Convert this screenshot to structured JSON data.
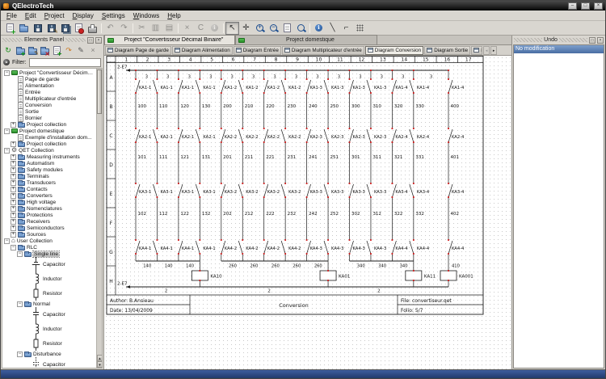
{
  "window": {
    "title": "QElectroTech"
  },
  "menu": {
    "items": [
      "File",
      "Edit",
      "Project",
      "Display",
      "Settings",
      "Windows",
      "Help"
    ]
  },
  "toolbar": {
    "buttons": [
      {
        "name": "new-diagram",
        "kind": "page",
        "ov": "plus"
      },
      {
        "name": "open-project",
        "kind": "folder"
      },
      {
        "name": "save",
        "kind": "floppy"
      },
      {
        "name": "save-as",
        "kind": "floppy",
        "ov": "pencil"
      },
      {
        "name": "save-all",
        "kind": "floppy",
        "ov": "stack"
      },
      {
        "name": "close-project",
        "kind": "page",
        "ov": "reddot"
      },
      {
        "name": "print",
        "kind": "printer"
      },
      {
        "sep": true
      },
      {
        "name": "undo",
        "glyph": "↶",
        "disabled": true
      },
      {
        "name": "redo",
        "glyph": "↷",
        "disabled": true
      },
      {
        "sep": true
      },
      {
        "name": "cut",
        "glyph": "✂",
        "disabled": true
      },
      {
        "name": "copy",
        "glyph": "▥",
        "disabled": true
      },
      {
        "name": "paste",
        "glyph": "▤",
        "disabled": true
      },
      {
        "sep": true
      },
      {
        "name": "delete",
        "glyph": "×",
        "disabled": true
      },
      {
        "name": "rotate",
        "glyph": "C",
        "disabled": true
      },
      {
        "name": "element-infos",
        "kind": "info",
        "disabled": true
      },
      {
        "sep": true
      },
      {
        "name": "select-mode",
        "glyph": "↖",
        "selected": true
      },
      {
        "name": "pan-mode",
        "glyph": "✛"
      },
      {
        "name": "zoom-in",
        "kind": "zoom",
        "glyph": "+"
      },
      {
        "name": "zoom-out",
        "kind": "zoom",
        "glyph": "−"
      },
      {
        "name": "zoom-content",
        "kind": "page"
      },
      {
        "name": "zoom-fit",
        "kind": "zoom"
      },
      {
        "sep": true
      },
      {
        "name": "diagram-properties",
        "kind": "info",
        "variant": "blue"
      },
      {
        "name": "add-line",
        "glyph": "╲"
      },
      {
        "name": "add-polyline",
        "glyph": "⌐"
      },
      {
        "name": "conductor-array",
        "kind": "grid"
      }
    ]
  },
  "elements_panel": {
    "title": "Elements Panel",
    "toolbar": [
      {
        "name": "reload-collections",
        "glyph": "↻",
        "color": "#138a13"
      },
      {
        "name": "new-category",
        "kind": "folder",
        "ov": "plus"
      },
      {
        "name": "edit-category",
        "kind": "folder",
        "ov": "pencil"
      },
      {
        "name": "delete-category",
        "kind": "folder",
        "ov": "cross"
      },
      {
        "name": "new-element",
        "kind": "page",
        "ov": "plus"
      },
      {
        "name": "import-element",
        "glyph": "↷",
        "color": "#cc7a22"
      },
      {
        "name": "edit-element",
        "glyph": "✎",
        "color": "#555555"
      },
      {
        "name": "delete-element",
        "glyph": "×",
        "disabled": true
      }
    ],
    "filter_label": "Filter:",
    "filter_value": "",
    "tree": [
      {
        "label": "Project \"Convertisseur Décimal...",
        "depth": 0,
        "exp": "open",
        "icon": "proj"
      },
      {
        "label": "Page de garde",
        "depth": 1,
        "icon": "page"
      },
      {
        "label": "Alimentation",
        "depth": 1,
        "icon": "page"
      },
      {
        "label": "Entrée",
        "depth": 1,
        "icon": "page"
      },
      {
        "label": "Multiplicateur d'entrée",
        "depth": 1,
        "icon": "page"
      },
      {
        "label": "Conversion",
        "depth": 1,
        "icon": "page"
      },
      {
        "label": "Sortie",
        "depth": 1,
        "icon": "page"
      },
      {
        "label": "Bornier",
        "depth": 1,
        "icon": "page"
      },
      {
        "label": "Project collection",
        "depth": 1,
        "exp": "closed",
        "icon": "coll"
      },
      {
        "label": "Project domestique",
        "depth": 0,
        "exp": "open",
        "icon": "proj"
      },
      {
        "label": "Exemple d'installation dom...",
        "depth": 1,
        "icon": "page"
      },
      {
        "label": "Project collection",
        "depth": 1,
        "exp": "closed",
        "icon": "coll"
      },
      {
        "label": "QET Collection",
        "depth": 0,
        "exp": "open",
        "icon": "gear"
      },
      {
        "label": "Measuring instruments",
        "depth": 1,
        "exp": "closed",
        "icon": "folder"
      },
      {
        "label": "Automatism",
        "depth": 1,
        "exp": "closed",
        "icon": "folder"
      },
      {
        "label": "Safety modules",
        "depth": 1,
        "exp": "closed",
        "icon": "folder"
      },
      {
        "label": "Terminals",
        "depth": 1,
        "exp": "closed",
        "icon": "folder"
      },
      {
        "label": "Transducers",
        "depth": 1,
        "exp": "closed",
        "icon": "folder"
      },
      {
        "label": "Contacts",
        "depth": 1,
        "exp": "closed",
        "icon": "folder"
      },
      {
        "label": "Converters",
        "depth": 1,
        "exp": "closed",
        "icon": "folder"
      },
      {
        "label": "High voltage",
        "depth": 1,
        "exp": "closed",
        "icon": "folder"
      },
      {
        "label": "Nomenclatures",
        "depth": 1,
        "exp": "closed",
        "icon": "folder"
      },
      {
        "label": "Protections",
        "depth": 1,
        "exp": "closed",
        "icon": "folder"
      },
      {
        "label": "Receivers",
        "depth": 1,
        "exp": "closed",
        "icon": "folder"
      },
      {
        "label": "Semiconductors",
        "depth": 1,
        "exp": "closed",
        "icon": "folder"
      },
      {
        "label": "Sources",
        "depth": 1,
        "exp": "closed",
        "icon": "folder"
      },
      {
        "label": "User Collection",
        "depth": 0,
        "exp": "open",
        "icon": "home"
      },
      {
        "label": "RLC",
        "depth": 1,
        "exp": "open",
        "icon": "folder"
      },
      {
        "label": "Single line",
        "depth": 2,
        "exp": "open",
        "icon": "folder",
        "selected": true
      },
      {
        "label": "Capacitor",
        "depth": 3,
        "symbol": "cap_sl"
      },
      {
        "label": "Inductor",
        "depth": 3,
        "symbol": "ind"
      },
      {
        "label": "Resistor",
        "depth": 3,
        "symbol": "res"
      },
      {
        "label": "Normal",
        "depth": 2,
        "exp": "open",
        "icon": "folder"
      },
      {
        "label": "Capacitor",
        "depth": 3,
        "symbol": "cap"
      },
      {
        "label": "Inductor",
        "depth": 3,
        "symbol": "ind"
      },
      {
        "label": "Resistor",
        "depth": 3,
        "symbol": "res"
      },
      {
        "label": "Disturbance",
        "depth": 2,
        "exp": "open",
        "icon": "folder"
      },
      {
        "label": "Capacitor",
        "depth": 3,
        "symbol": "cap_d"
      }
    ]
  },
  "project_tabs": [
    {
      "label": "Project \"Convertisseur Décimal Binaire\"",
      "active": true
    },
    {
      "label": "Project domestique",
      "active": false
    }
  ],
  "diagram_tabs": {
    "tabs": [
      "Diagram Page de garde",
      "Diagram Alimentation",
      "Diagram Entrée",
      "Diagram Multiplicateur d'entrée",
      "Diagram Conversion",
      "Diagram Sortie"
    ],
    "active": "Diagram Conversion",
    "overflow_partial": "Diagram",
    "scroll_left": "◂",
    "scroll_right": "▸"
  },
  "undo_panel": {
    "title": "Undo",
    "items": [
      "No modification"
    ]
  },
  "schematic": {
    "columns": [
      "1",
      "2",
      "3",
      "4",
      "5",
      "6",
      "7",
      "8",
      "9",
      "10",
      "11",
      "12",
      "13",
      "14",
      "15",
      "16",
      "17"
    ],
    "rows": [
      "A",
      "B",
      "C",
      "D",
      "E",
      "F",
      "G",
      "H"
    ],
    "folio_ref": "2-E7",
    "top_segment_label": "3",
    "bottom_segment_label": "2",
    "contact_rows": [
      {
        "row": "A",
        "labels": [
          "KA1-1",
          "KA1-1",
          "KA1-1",
          "KA1-1",
          "KA1-2",
          "KA1-2",
          "KA1-2",
          "KA1-2",
          "KA1-3",
          "KA1-3",
          "KA1-3",
          "KA1-3",
          "KA1-4",
          "KA1-4",
          "KA1-4"
        ]
      },
      {
        "row": "C",
        "labels": [
          "KA2-1",
          "KA2-1",
          "KA2-1",
          "KA2-1",
          "KA2-2",
          "KA2-2",
          "KA2-2",
          "KA2-2",
          "KA2-3",
          "KA2-3",
          "KA2-3",
          "KA2-3",
          "KA2-4",
          "KA2-4",
          "KA2-4"
        ]
      },
      {
        "row": "E",
        "labels": [
          "KA3-1",
          "KA3-1",
          "KA3-1",
          "KA3-1",
          "KA3-2",
          "KA3-2",
          "KA3-2",
          "KA3-2",
          "KA3-3",
          "KA3-3",
          "KA3-3",
          "KA3-3",
          "KA3-4",
          "KA3-4",
          "KA3-4"
        ]
      },
      {
        "row": "G",
        "labels": [
          "KA4-1",
          "KA4-1",
          "KA4-1",
          "KA4-1",
          "KA4-2",
          "KA4-2",
          "KA4-2",
          "KA4-2",
          "KA4-3",
          "KA4-3",
          "KA4-3",
          "KA4-3",
          "KA4-4",
          "KA4-4",
          "KA4-4"
        ]
      }
    ],
    "wire_numbers": [
      {
        "row": "B",
        "values": [
          "100",
          "110",
          "120",
          "130",
          "200",
          "210",
          "220",
          "230",
          "240",
          "250",
          "300",
          "310",
          "320",
          "330",
          "400"
        ]
      },
      {
        "row": "D",
        "values": [
          "101",
          "111",
          "121",
          "131",
          "201",
          "211",
          "221",
          "231",
          "241",
          "251",
          "301",
          "311",
          "321",
          "331",
          "401"
        ]
      },
      {
        "row": "F",
        "values": [
          "102",
          "112",
          "122",
          "132",
          "202",
          "212",
          "222",
          "232",
          "242",
          "252",
          "302",
          "312",
          "322",
          "332",
          "402"
        ]
      }
    ],
    "sub_buses": [
      {
        "label": "140",
        "from": 0,
        "to": 3
      },
      {
        "label": "260",
        "from": 4,
        "to": 9
      },
      {
        "label": "340",
        "from": 10,
        "to": 13
      }
    ],
    "drop_wire_label": "410",
    "coils": [
      {
        "label": "KA10",
        "wire": 3
      },
      {
        "label": "KA01",
        "wire": 9
      },
      {
        "label": "KA11",
        "wire": 13
      },
      {
        "label": "KA001",
        "wire": 14
      }
    ],
    "title_block": {
      "author": "Author: B.Ansieau",
      "date": "Date: 13/04/2009",
      "title": "Conversion",
      "file": "File: convertiseur.qet",
      "folio": "Folio: 5/7"
    }
  }
}
